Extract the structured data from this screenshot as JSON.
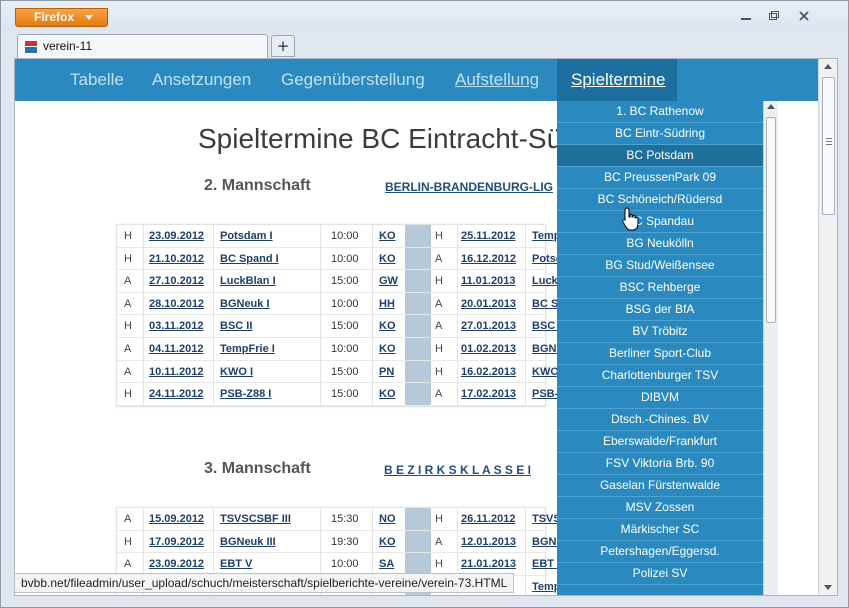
{
  "browser": {
    "menu_button": "Firefox",
    "tab_title": "verein-11",
    "status_url": "bvbb.net/fileadmin/user_upload/schuch/meisterschaft/spielberichte-vereine/verein-73.HTML"
  },
  "nav": {
    "items": [
      "Tabelle",
      "Ansetzungen",
      "Gegenüberstellung",
      "Aufstellung"
    ],
    "active": "Spieltermine"
  },
  "page": {
    "title": "Spieltermine BC Eintracht-Sü",
    "sections": [
      {
        "team": "2. Mannschaft",
        "league": "BERLIN-BRANDENBURG-LIG",
        "rows": [
          [
            "H",
            "23.09.2012",
            "Potsdam I",
            "10:00",
            "KO",
            "H",
            "25.11.2012",
            "Temp"
          ],
          [
            "H",
            "21.10.2012",
            "BC Spand I",
            "10:00",
            "KO",
            "A",
            "16.12.2012",
            "Potsd"
          ],
          [
            "A",
            "27.10.2012",
            "LuckBlan I",
            "15:00",
            "GW",
            "H",
            "11.01.2013",
            "LuckB"
          ],
          [
            "A",
            "28.10.2012",
            "BGNeuk I",
            "10:00",
            "HH",
            "A",
            "20.01.2013",
            "BC Sp"
          ],
          [
            "H",
            "03.11.2012",
            "BSC II",
            "15:00",
            "KO",
            "A",
            "27.01.2013",
            "BSC I"
          ],
          [
            "A",
            "04.11.2012",
            "TempFrie I",
            "10:00",
            "KO",
            "H",
            "01.02.2013",
            "BGNe"
          ],
          [
            "A",
            "10.11.2012",
            "KWO I",
            "15:00",
            "PN",
            "H",
            "16.02.2013",
            "KWO"
          ],
          [
            "H",
            "24.11.2012",
            "PSB-Z88 I",
            "15:00",
            "KO",
            "A",
            "17.02.2013",
            "PSB-Z"
          ]
        ]
      },
      {
        "team": "3. Mannschaft",
        "league": "B E Z I R K S K L A S S E   I",
        "rows": [
          [
            "A",
            "15.09.2012",
            "TSVSCSBF III",
            "15:30",
            "NO",
            "H",
            "26.11.2012",
            "TSVS"
          ],
          [
            "H",
            "17.09.2012",
            "BGNeuk III",
            "19:30",
            "KO",
            "A",
            "12.01.2013",
            "BGNe"
          ],
          [
            "A",
            "23.09.2012",
            "EBT V",
            "10:00",
            "SA",
            "H",
            "21.01.2013",
            "EBT V"
          ],
          [
            "",
            "",
            "",
            "",
            "",
            "",
            "",
            "Temp"
          ]
        ]
      }
    ]
  },
  "dropdown": {
    "hovered_index": 2,
    "items": [
      "1. BC Rathenow",
      "BC Eintr-Südring",
      "BC Potsdam",
      "BC PreussenPark 09",
      "BC Schöneich/Rüdersd",
      "BC Spandau",
      "BG Neukölln",
      "BG Stud/Weißensee",
      "BSC Rehberge",
      "BSG der BfA",
      "BV Tröbitz",
      "Berliner Sport-Club",
      "Charlottenburger TSV",
      "DIBVM",
      "Dtsch.-Chines. BV",
      "Eberswalde/Frankfurt",
      "FSV Viktoria Brb. 90",
      "Gaselan Fürstenwalde",
      "MSV Zossen",
      "Märkischer SC",
      "Petershagen/Eggersd.",
      "Polizei SV",
      ""
    ]
  },
  "colors": {
    "nav_bg": "#2a8ac0",
    "nav_active": "#1c6f9f",
    "firefox_orange": "#e57a12"
  }
}
